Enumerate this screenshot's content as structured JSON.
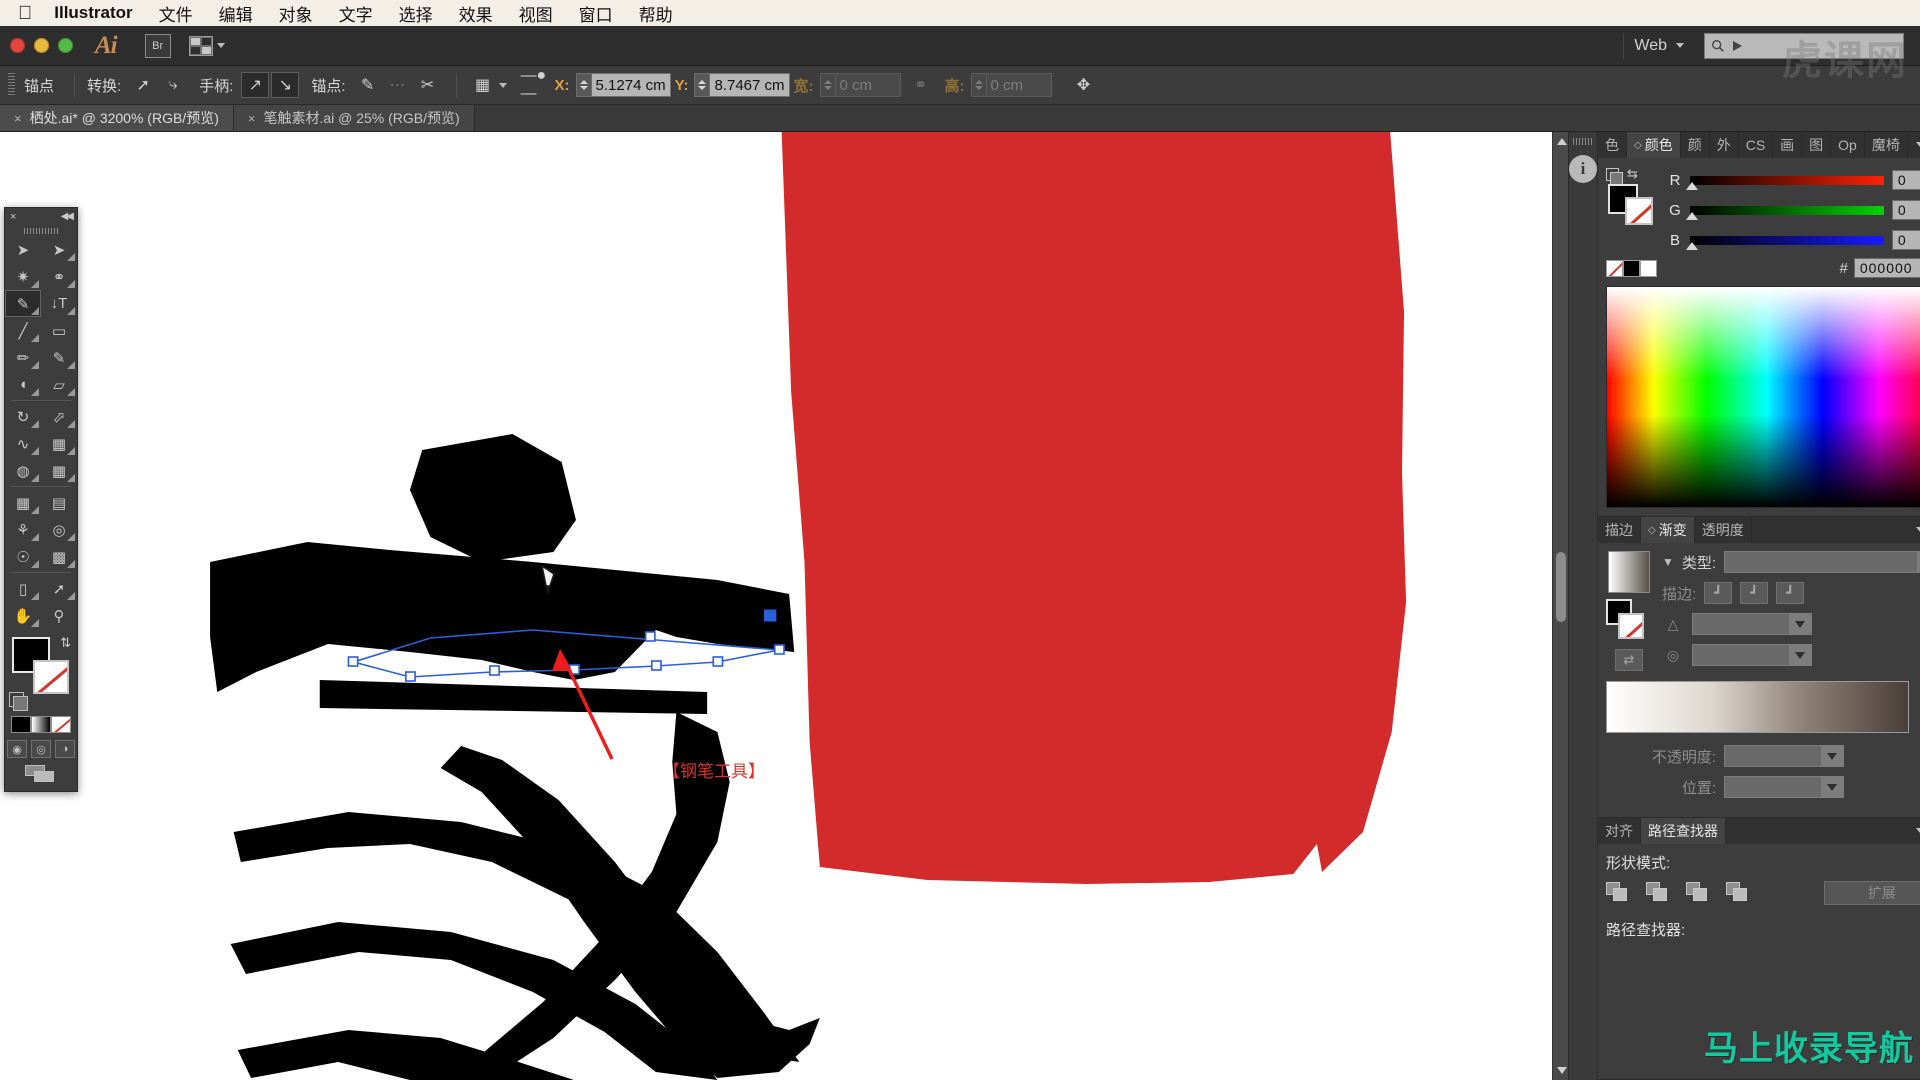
{
  "mac_menu": {
    "apple_icon": "apple-logo",
    "app_name": "Illustrator",
    "items": [
      "文件",
      "编辑",
      "对象",
      "文字",
      "选择",
      "效果",
      "视图",
      "窗口",
      "帮助"
    ]
  },
  "app_bar": {
    "logo": "Ai",
    "bridge_label": "Br",
    "workspace_label": "Web",
    "search_placeholder": ""
  },
  "control_bar": {
    "context_label": "锚点",
    "convert_label": "转换:",
    "handles_label": "手柄:",
    "anchor_label": "锚点:",
    "x_label": "X:",
    "x_value": "5.1274 cm",
    "y_label": "Y:",
    "y_value": "8.7467 cm",
    "w_label": "宽:",
    "w_value": "0 cm",
    "h_label": "高:",
    "h_value": "0 cm",
    "icons": [
      "convert-to-corner-icon",
      "convert-to-smooth-icon",
      "show-handles-icon",
      "hide-handles-icon",
      "remove-anchor-icon",
      "connect-anchor-icon",
      "cut-path-icon",
      "isolate-selected-icon",
      "align-icon",
      "constrain-icon",
      "transform-icon"
    ]
  },
  "doc_tabs": [
    {
      "close": "×",
      "label": "栖处.ai* @ 3200% (RGB/预览)",
      "active": true
    },
    {
      "close": "×",
      "label": "笔触素材.ai @ 25% (RGB/预览)",
      "active": false
    }
  ],
  "toolbox": {
    "close": "×",
    "collapse": "◀◀",
    "tools": [
      {
        "name": "selection-tool",
        "glyph": "➤"
      },
      {
        "name": "direct-selection-tool",
        "glyph": "➤"
      },
      {
        "name": "magic-wand-tool",
        "glyph": "✳"
      },
      {
        "name": "lasso-tool",
        "glyph": "◠"
      },
      {
        "name": "pen-tool",
        "glyph": "✒",
        "selected": true
      },
      {
        "name": "type-tool",
        "glyph": "T"
      },
      {
        "name": "line-segment-tool",
        "glyph": "╱"
      },
      {
        "name": "rectangle-tool",
        "glyph": "▭"
      },
      {
        "name": "paintbrush-tool",
        "glyph": "🖌"
      },
      {
        "name": "pencil-tool",
        "glyph": "✏"
      },
      {
        "name": "blob-brush-tool",
        "glyph": "◖"
      },
      {
        "name": "eraser-tool",
        "glyph": "▱"
      },
      {
        "name": "rotate-tool",
        "glyph": "↻"
      },
      {
        "name": "scale-tool",
        "glyph": "⇱"
      },
      {
        "name": "width-tool",
        "glyph": "∿"
      },
      {
        "name": "free-transform-tool",
        "glyph": "⬚"
      },
      {
        "name": "shape-builder-tool",
        "glyph": "◍"
      },
      {
        "name": "perspective-grid-tool",
        "glyph": "◪"
      },
      {
        "name": "mesh-tool",
        "glyph": "▦"
      },
      {
        "name": "gradient-tool",
        "glyph": "▤"
      },
      {
        "name": "eyedropper-tool",
        "glyph": "⚲"
      },
      {
        "name": "blend-tool",
        "glyph": "◎"
      },
      {
        "name": "symbol-sprayer-tool",
        "glyph": "☄"
      },
      {
        "name": "column-graph-tool",
        "glyph": "▥"
      },
      {
        "name": "artboard-tool",
        "glyph": "⬜"
      },
      {
        "name": "slice-tool",
        "glyph": "✂"
      },
      {
        "name": "hand-tool",
        "glyph": "✋"
      },
      {
        "name": "zoom-tool",
        "glyph": "🔍"
      }
    ],
    "fill_color": "#000000",
    "stroke_color": "none",
    "color_modes": [
      "color-mode-button",
      "gradient-mode-button",
      "none-mode-button"
    ],
    "draw_modes": [
      "draw-normal-button",
      "draw-behind-button",
      "draw-inside-button"
    ],
    "screen_mode": "change-screen-mode-button"
  },
  "canvas": {
    "annotation_text": "【钢笔工具】",
    "annotation_color": "#d7362c",
    "shape_red_color": "#d32b2b",
    "artwork_glyph": "家",
    "selected_path_anchor_count": 8
  },
  "color_panel": {
    "tabs": [
      "色",
      "颜色",
      "颜",
      "外",
      "CS",
      "画",
      "图",
      "Op",
      "魔椅"
    ],
    "active_tab": "颜色",
    "channels": [
      {
        "label": "R",
        "value": "0",
        "color": "#ff2200"
      },
      {
        "label": "G",
        "value": "0",
        "color": "#00b400"
      },
      {
        "label": "B",
        "value": "0",
        "color": "#1111ff"
      }
    ],
    "hex_label": "#",
    "hex_value": "000000"
  },
  "gradient_panel": {
    "tabs": [
      "描边",
      "渐变",
      "透明度"
    ],
    "active_tab": "渐变",
    "type_label": "类型:",
    "type_value": "",
    "stroke_label": "描边:",
    "angle_label": "angle-field",
    "aspect_label": "aspect-field",
    "opacity_label": "不透明度:",
    "opacity_value": "",
    "location_label": "位置:",
    "location_value": "",
    "delete_icon": "trash-icon"
  },
  "pathfinder_panel": {
    "tabs": [
      "对齐",
      "路径查找器"
    ],
    "active_tab": "路径查找器",
    "shape_modes_label": "形状模式:",
    "expand_label": "扩展",
    "pathfinders_label": "路径查找器:",
    "shape_mode_buttons": [
      "unite-button",
      "minus-front-button",
      "intersect-button",
      "exclude-button"
    ]
  },
  "watermarks": {
    "top_right": "虎课网",
    "bottom_right": "马上收录导航"
  }
}
